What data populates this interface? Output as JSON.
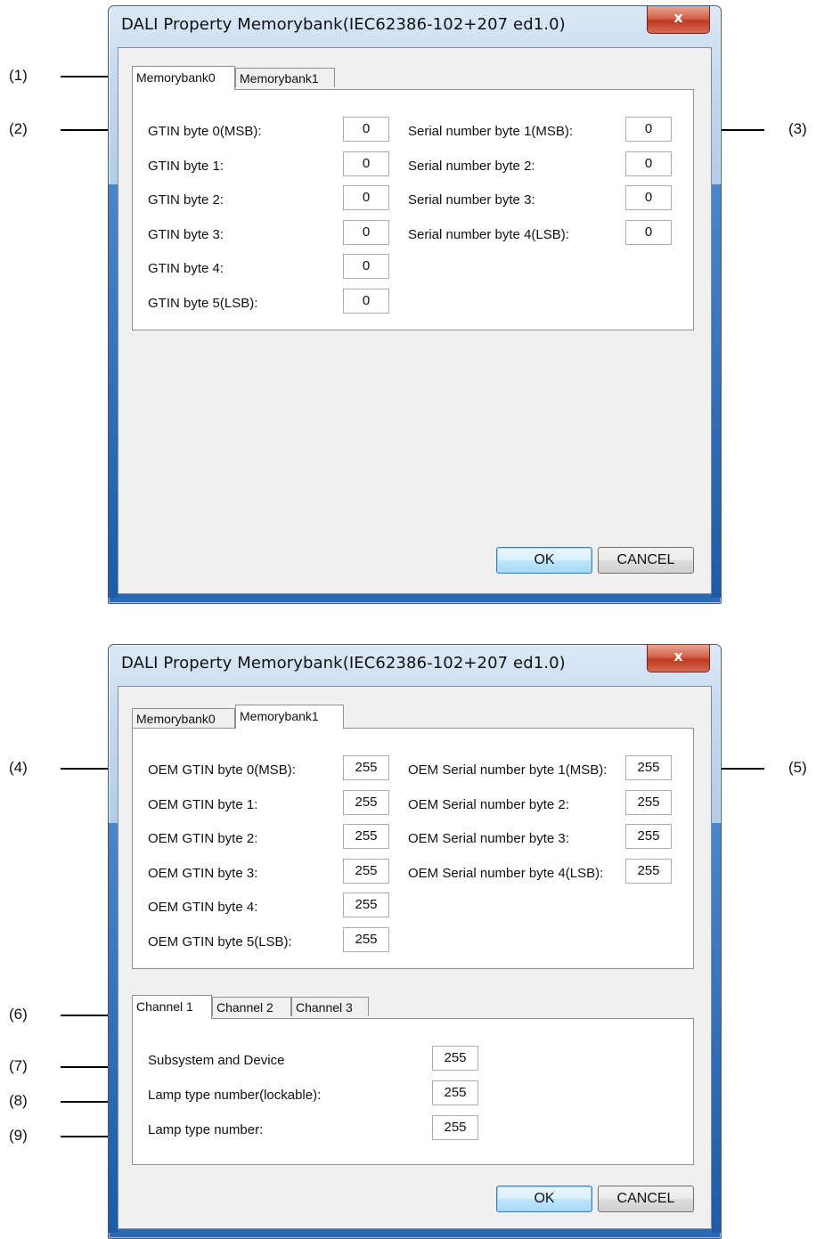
{
  "callouts": [
    "(1)",
    "(2)",
    "(3)",
    "(4)",
    "(5)",
    "(6)",
    "(7)",
    "(8)",
    "(9)"
  ],
  "dialog1": {
    "title": "DALI Property Memorybank(IEC62386-102+207 ed1.0)",
    "close_glyph": "x",
    "tabs": [
      "Memorybank0",
      "Memorybank1"
    ],
    "active_tab": "Memorybank0",
    "left_fields": [
      {
        "label": "GTIN byte 0(MSB):",
        "value": "0"
      },
      {
        "label": "GTIN byte 1:",
        "value": "0"
      },
      {
        "label": "GTIN byte 2:",
        "value": "0"
      },
      {
        "label": "GTIN byte 3:",
        "value": "0"
      },
      {
        "label": "GTIN byte 4:",
        "value": "0"
      },
      {
        "label": "GTIN byte 5(LSB):",
        "value": "0"
      }
    ],
    "right_fields": [
      {
        "label": "Serial number byte 1(MSB):",
        "value": "0"
      },
      {
        "label": "Serial number byte 2:",
        "value": "0"
      },
      {
        "label": "Serial number byte 3:",
        "value": "0"
      },
      {
        "label": "Serial number byte 4(LSB):",
        "value": "0"
      }
    ],
    "ok_label": "OK",
    "cancel_label": "CANCEL"
  },
  "dialog2": {
    "title": "DALI Property Memorybank(IEC62386-102+207 ed1.0)",
    "close_glyph": "x",
    "tabs": [
      "Memorybank0",
      "Memorybank1"
    ],
    "active_tab": "Memorybank1",
    "left_fields": [
      {
        "label": "OEM GTIN byte 0(MSB):",
        "value": "255"
      },
      {
        "label": "OEM GTIN byte 1:",
        "value": "255"
      },
      {
        "label": "OEM GTIN byte 2:",
        "value": "255"
      },
      {
        "label": "OEM GTIN byte 3:",
        "value": "255"
      },
      {
        "label": "OEM GTIN byte 4:",
        "value": "255"
      },
      {
        "label": "OEM GTIN byte 5(LSB):",
        "value": "255"
      }
    ],
    "right_fields": [
      {
        "label": "OEM Serial number byte 1(MSB):",
        "value": "255"
      },
      {
        "label": "OEM Serial number byte 2:",
        "value": "255"
      },
      {
        "label": "OEM Serial number byte 3:",
        "value": "255"
      },
      {
        "label": "OEM Serial number byte 4(LSB):",
        "value": "255"
      }
    ],
    "channel_tabs": [
      "Channel 1",
      "Channel 2",
      "Channel 3"
    ],
    "active_channel": "Channel 1",
    "channel_fields": [
      {
        "label": "Subsystem and Device",
        "value": "255"
      },
      {
        "label": "Lamp type number(lockable):",
        "value": "255"
      },
      {
        "label": "Lamp type number:",
        "value": "255"
      }
    ],
    "ok_label": "OK",
    "cancel_label": "CANCEL"
  }
}
